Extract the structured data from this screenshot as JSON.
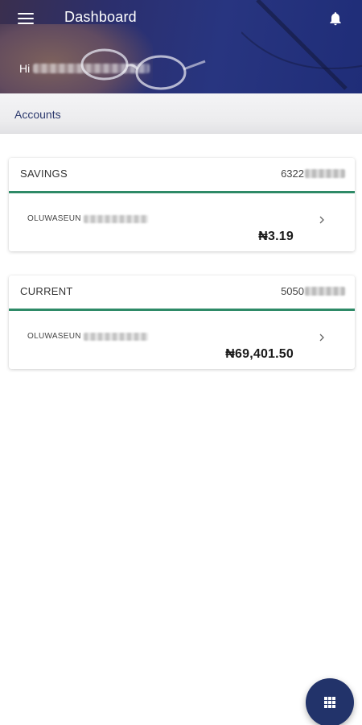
{
  "header": {
    "title": "Dashboard",
    "greeting_prefix": "Hi",
    "menu_icon": "hamburger-menu-icon",
    "notification_icon": "bell-icon"
  },
  "section": {
    "label": "Accounts"
  },
  "accounts": [
    {
      "type": "SAVINGS",
      "number_prefix": "6322",
      "holder_first_name": "OLUWASEUN",
      "balance": "₦3.19"
    },
    {
      "type": "CURRENT",
      "number_prefix": "5050",
      "holder_first_name": "OLUWASEUN",
      "balance": "₦69,401.50"
    }
  ],
  "fab": {
    "icon": "grid-apps-icon"
  },
  "colors": {
    "header_bg": "#283580",
    "accent_green": "#2e8a67",
    "fab_bg": "#22336a",
    "section_text": "#2d3a6e"
  }
}
